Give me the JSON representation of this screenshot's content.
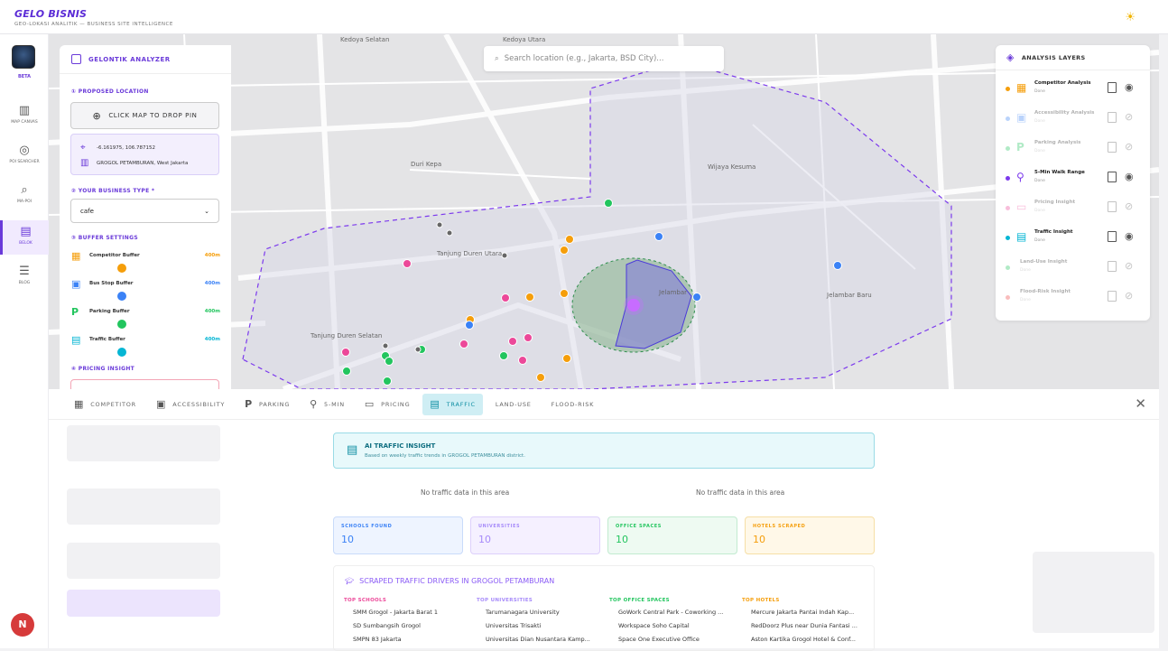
{
  "app": {
    "title": "GELO BISNIS",
    "subtitle": "GEO-LOKASI ANALITIK — BUSINESS SITE INTELLIGENCE",
    "theme_icon": "sun-icon"
  },
  "rail": {
    "beta": "BETA",
    "items": [
      {
        "label": "MAP CANVAS",
        "icon": "map-icon"
      },
      {
        "label": "POI SEARCHER",
        "icon": "radar-icon"
      },
      {
        "label": "MA-POI",
        "icon": "search-icon"
      },
      {
        "label": "BELOK",
        "icon": "chart-icon",
        "active": true
      },
      {
        "label": "BLOG",
        "icon": "document-icon"
      }
    ],
    "avatar": "N"
  },
  "analyzer": {
    "title": "GELONTIK ANALYZER",
    "proposed_location": "① PROPOSED LOCATION",
    "drop_pin": "CLICK MAP TO DROP PIN",
    "coords": "-6.161975, 106.787152",
    "district": "GROGOL PETAMBURAN, West Jakarta",
    "business_type_label": "② YOUR BUSINESS TYPE *",
    "business_type": "cafe",
    "buffer_label": "③ BUFFER SETTINGS",
    "buffers": [
      {
        "name": "Competitor Buffer",
        "value": "400m",
        "color": "#f59e0b"
      },
      {
        "name": "Bus Stop Buffer",
        "value": "400m",
        "color": "#3b82f6"
      },
      {
        "name": "Parking Buffer",
        "value": "400m",
        "color": "#22c55e"
      },
      {
        "name": "Traffic Buffer",
        "value": "400m",
        "color": "#06b6d4"
      }
    ],
    "pricing_label": "④ PRICING INSIGHT"
  },
  "map": {
    "search_placeholder": "Search location (e.g., Jakarta, BSD City)...",
    "labels": [
      "Kedoya Selatan",
      "Kedoya Utara",
      "Duri Kepa",
      "Wijaya Kesuma",
      "Tanjung Duren Utara",
      "Jelambar",
      "Jelambar Baru",
      "Tanjung Duren Selatan"
    ]
  },
  "layers": {
    "title": "ANALYSIS LAYERS",
    "items": [
      {
        "name": "Competitor Analysis",
        "status": "Done",
        "color": "#f59e0b",
        "visible": true,
        "icon": "store-icon"
      },
      {
        "name": "Accessibility Analysis",
        "status": "Done",
        "color": "#3b82f6",
        "visible": false,
        "icon": "bus-icon"
      },
      {
        "name": "Parking Analysis",
        "status": "Done",
        "color": "#22c55e",
        "visible": false,
        "icon": "parking-icon"
      },
      {
        "name": "5-Min Walk Range",
        "status": "Done",
        "color": "#7c3aed",
        "visible": true,
        "icon": "walk-icon"
      },
      {
        "name": "Pricing Insight",
        "status": "Done",
        "color": "#ec4899",
        "visible": false,
        "icon": "money-icon"
      },
      {
        "name": "Traffic Insight",
        "status": "Done",
        "color": "#06b6d4",
        "visible": true,
        "icon": "traffic-light-icon"
      },
      {
        "name": "Land-Use Insight",
        "status": "Done",
        "color": "#22c55e",
        "visible": false,
        "icon": "land-icon"
      },
      {
        "name": "Flood-Risk Insight",
        "status": "Done",
        "color": "#ef4444",
        "visible": false,
        "icon": "flood-icon"
      }
    ]
  },
  "tabs": [
    {
      "label": "COMPETITOR",
      "icon": "store-icon"
    },
    {
      "label": "ACCESSIBILITY",
      "icon": "bus-icon"
    },
    {
      "label": "PARKING",
      "icon": "parking-icon"
    },
    {
      "label": "5-MIN",
      "icon": "walk-icon"
    },
    {
      "label": "PRICING",
      "icon": "money-icon"
    },
    {
      "label": "TRAFFIC",
      "icon": "traffic-light-icon",
      "active": true
    },
    {
      "label": "LAND-USE",
      "icon": ""
    },
    {
      "label": "FLOOD-RISK",
      "icon": ""
    }
  ],
  "traffic": {
    "title": "AI TRAFFIC INSIGHT",
    "subtitle": "Based on weekly traffic trends in GROGOL PETAMBURAN district.",
    "no_data_1": "No traffic data in this area",
    "no_data_2": "No traffic data in this area",
    "stats": [
      {
        "label": "SCHOOLS FOUND",
        "value": "10",
        "color": "#3b82f6",
        "bg": "#eef4ff",
        "border": "#c9dbfa"
      },
      {
        "label": "UNIVERSITIES",
        "value": "10",
        "color": "#a78bfa",
        "bg": "#f5f0ff",
        "border": "#ddd0fb"
      },
      {
        "label": "OFFICE SPACES",
        "value": "10",
        "color": "#22c55e",
        "bg": "#eefaf2",
        "border": "#c2ebd0"
      },
      {
        "label": "HOTELS SCRAPED",
        "value": "10",
        "color": "#f59e0b",
        "bg": "#fff8e8",
        "border": "#f6dfa6"
      }
    ],
    "drivers_title": "SCRAPED TRAFFIC DRIVERS IN GROGOL PETAMBURAN",
    "columns": [
      {
        "head": "TOP SCHOOLS",
        "color": "#ec4899",
        "items": [
          "SMM Grogol - Jakarta Barat 1",
          "SD Sumbangsih Grogol",
          "SMPN 83 Jakarta"
        ]
      },
      {
        "head": "TOP UNIVERSITIES",
        "color": "#a78bfa",
        "items": [
          "Tarumanagara University",
          "Universitas Trisakti",
          "Universitas Dian Nusantara Kamp..."
        ]
      },
      {
        "head": "TOP OFFICE SPACES",
        "color": "#22c55e",
        "items": [
          "GoWork Central Park - Coworking ...",
          "Workspace Soho Capital",
          "Space One Executive Office"
        ]
      },
      {
        "head": "TOP HOTELS",
        "color": "#f59e0b",
        "items": [
          "Mercure Jakarta Pantai Indah Kap...",
          "RedDoorz Plus near Dunia Fantasi ...",
          "Aston Kartika Grogol Hotel & Conf..."
        ]
      }
    ]
  }
}
